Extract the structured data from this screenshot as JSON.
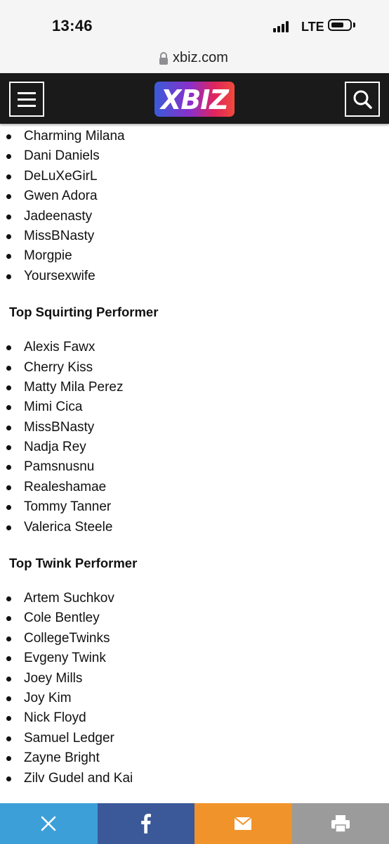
{
  "status_bar": {
    "time": "13:46",
    "network": "LTE"
  },
  "browser": {
    "url": "xbiz.com"
  },
  "header": {
    "logo_text": "XBIZ"
  },
  "sections": [
    {
      "heading": "",
      "items": [
        "Charming Milana",
        "Dani Daniels",
        "DeLuXeGirL",
        "Gwen Adora",
        "Jadeenasty",
        "MissBNasty",
        "Morgpie",
        "Yoursexwife"
      ]
    },
    {
      "heading": "Top Squirting Performer",
      "items": [
        "Alexis Fawx",
        "Cherry Kiss",
        "Matty Mila Perez",
        "Mimi Cica",
        "MissBNasty",
        "Nadja Rey",
        "Pamsnusnu",
        "Realeshamae",
        "Tommy Tanner",
        "Valerica Steele"
      ]
    },
    {
      "heading": "Top Twink Performer",
      "items": [
        "Artem Suchkov",
        "Cole Bentley",
        "CollegeTwinks",
        "Evgeny Twink",
        "Joey Mills",
        "Joy Kim",
        "Nick Floyd",
        "Samuel Ledger",
        "Zayne Bright",
        "Zilv Gudel and Kai"
      ]
    }
  ],
  "share_bar": {
    "buttons": [
      {
        "icon": "x-icon",
        "color": "#3d9fd8"
      },
      {
        "icon": "facebook-icon",
        "color": "#3b5998"
      },
      {
        "icon": "mail-icon",
        "color": "#f0932b"
      },
      {
        "icon": "print-icon",
        "color": "#9b9b9b"
      }
    ]
  }
}
